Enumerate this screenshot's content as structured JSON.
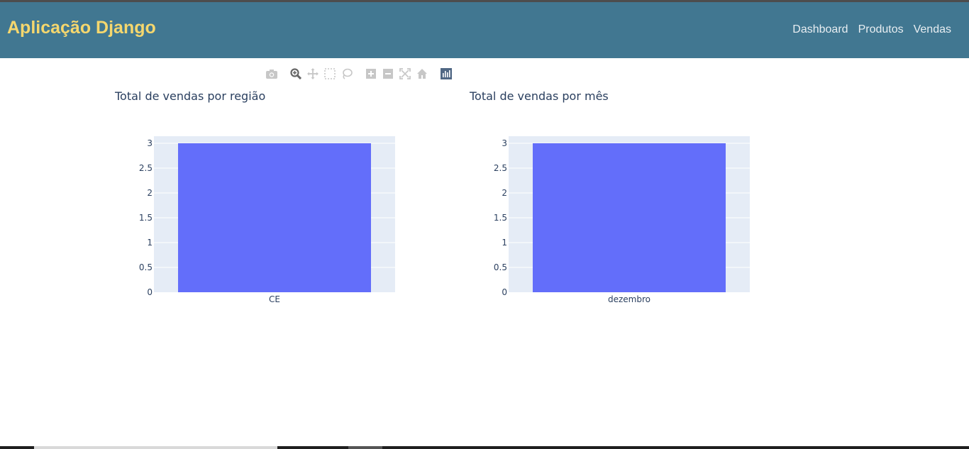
{
  "navbar": {
    "brand": "Aplicação Django",
    "links": [
      "Dashboard",
      "Produtos",
      "Vendas"
    ]
  },
  "colors": {
    "navbar_bg": "#417791",
    "brand": "#f5d76e",
    "bar": "#636efa",
    "plot_bg": "#e5ecf6"
  },
  "modebar": {
    "icons": [
      "camera-icon",
      "zoom-icon",
      "pan-icon",
      "box-select-icon",
      "lasso-select-icon",
      "zoom-in-icon",
      "zoom-out-icon",
      "autoscale-icon",
      "reset-axes-icon",
      "plotly-logo-icon"
    ]
  },
  "chart_data": [
    {
      "type": "bar",
      "title": "Total de vendas por região",
      "categories": [
        "CE"
      ],
      "values": [
        3
      ],
      "xlabel": "",
      "ylabel": "",
      "ylim": [
        0,
        3
      ],
      "yticks": [
        "0",
        "0.5",
        "1",
        "1.5",
        "2",
        "2.5",
        "3"
      ],
      "grid": true
    },
    {
      "type": "bar",
      "title": "Total de vendas por mês",
      "categories": [
        "dezembro"
      ],
      "values": [
        3
      ],
      "xlabel": "",
      "ylabel": "",
      "ylim": [
        0,
        3
      ],
      "yticks": [
        "0",
        "0.5",
        "1",
        "1.5",
        "2",
        "2.5",
        "3"
      ],
      "grid": true
    }
  ]
}
